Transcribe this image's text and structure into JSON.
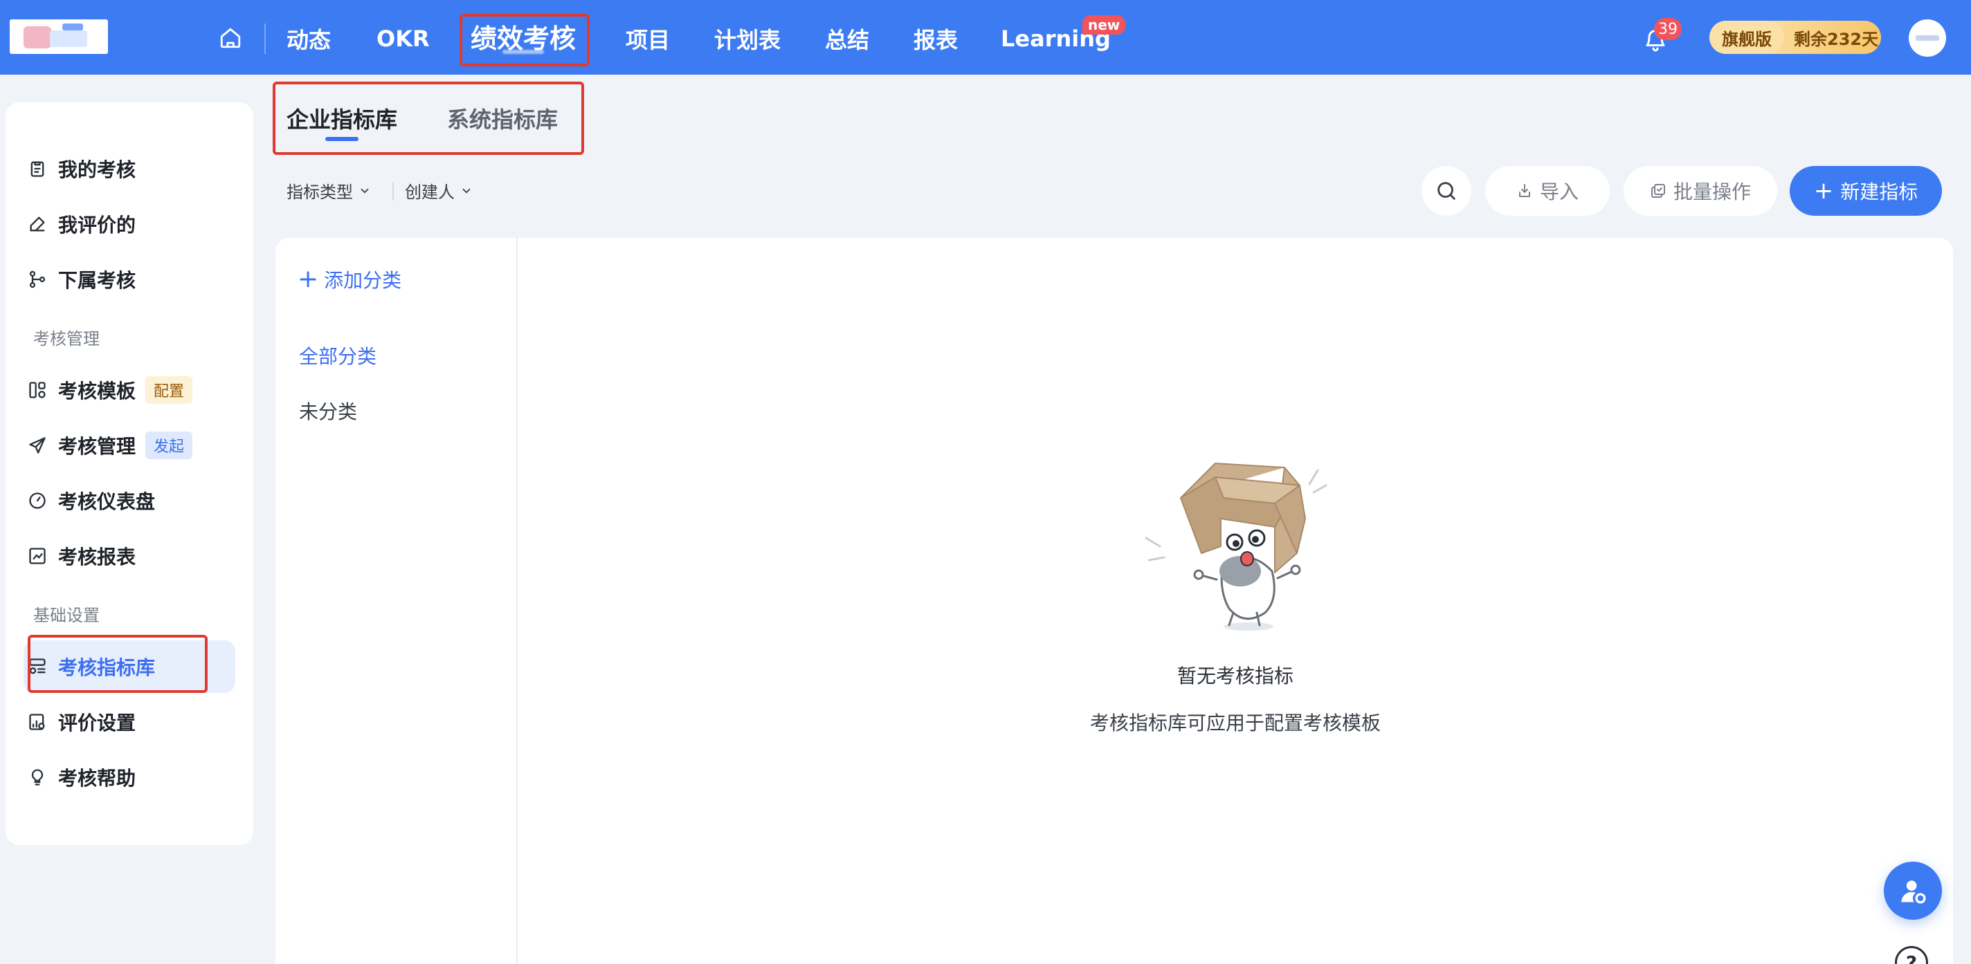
{
  "topnav": {
    "items": [
      {
        "label": "动态"
      },
      {
        "label": "OKR"
      },
      {
        "label": "绩效考核"
      },
      {
        "label": "项目"
      },
      {
        "label": "计划表"
      },
      {
        "label": "总结"
      },
      {
        "label": "报表"
      },
      {
        "label": "Learning"
      }
    ],
    "new_badge": "new",
    "notification_count": "39",
    "edition_label": "旗舰版",
    "edition_remaining": "剩余232天"
  },
  "sidebar": {
    "items": [
      {
        "label": "我的考核",
        "icon": "clipboard-icon"
      },
      {
        "label": "我评价的",
        "icon": "pen-icon"
      },
      {
        "label": "下属考核",
        "icon": "branch-icon"
      },
      {
        "label": "考核模板",
        "icon": "template-icon",
        "tag": "配置"
      },
      {
        "label": "考核管理",
        "icon": "send-icon",
        "tag": "发起"
      },
      {
        "label": "考核仪表盘",
        "icon": "gauge-icon"
      },
      {
        "label": "考核报表",
        "icon": "chart-icon"
      },
      {
        "label": "考核指标库",
        "icon": "indicator-list-icon"
      },
      {
        "label": "评价设置",
        "icon": "rating-settings-icon"
      },
      {
        "label": "考核帮助",
        "icon": "bulb-icon"
      }
    ],
    "sections": [
      "考核管理",
      "基础设置"
    ]
  },
  "tabs": [
    "企业指标库",
    "系统指标库"
  ],
  "filters": [
    "指标类型",
    "创建人"
  ],
  "actions": {
    "import": "导入",
    "batch": "批量操作",
    "new_indicator": "新建指标"
  },
  "categories": {
    "add": "添加分类",
    "items": [
      "全部分类",
      "未分类"
    ]
  },
  "empty_state": {
    "title": "暂无考核指标",
    "description": "考核指标库可应用于配置考核模板"
  },
  "help_label": "?",
  "colors": {
    "brand": "#3d7bf2",
    "highlight_box": "#e03a2f",
    "active_text": "#3d6ff0"
  }
}
